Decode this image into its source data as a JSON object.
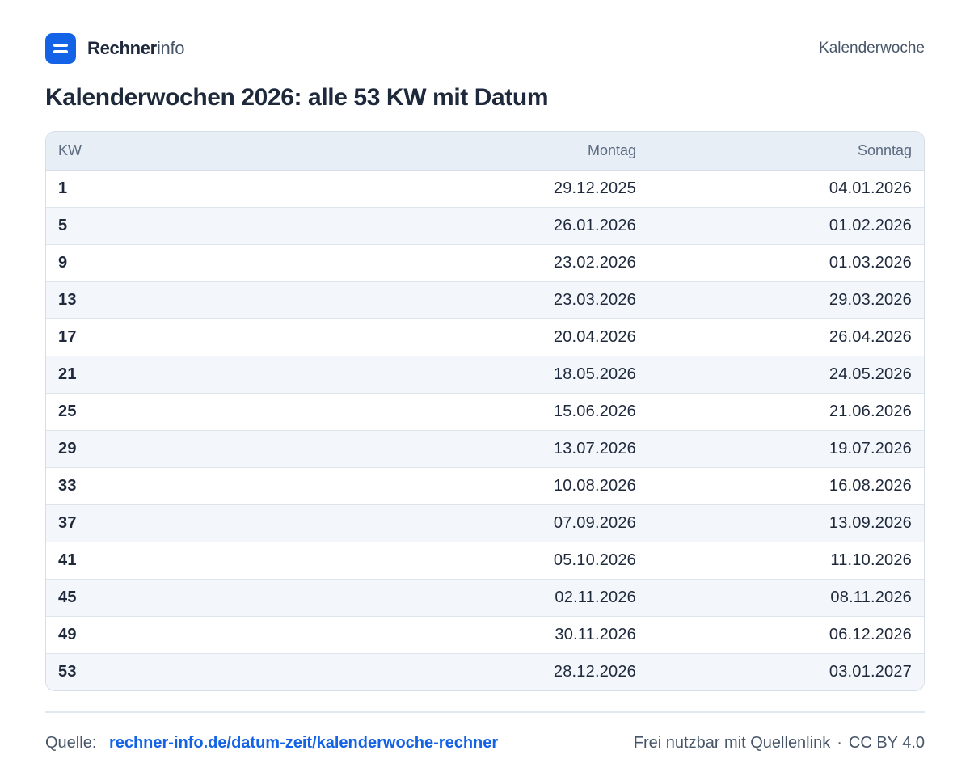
{
  "brand": {
    "name_bold": "Rechner",
    "name_light": "info"
  },
  "header": {
    "section_link": "Kalenderwoche"
  },
  "page": {
    "title": "Kalenderwochen 2026: alle 53 KW mit Datum"
  },
  "table": {
    "headers": [
      "KW",
      "Montag",
      "Sonntag"
    ],
    "rows": [
      [
        "1",
        "29.12.2025",
        "04.01.2026"
      ],
      [
        "5",
        "26.01.2026",
        "01.02.2026"
      ],
      [
        "9",
        "23.02.2026",
        "01.03.2026"
      ],
      [
        "13",
        "23.03.2026",
        "29.03.2026"
      ],
      [
        "17",
        "20.04.2026",
        "26.04.2026"
      ],
      [
        "21",
        "18.05.2026",
        "24.05.2026"
      ],
      [
        "25",
        "15.06.2026",
        "21.06.2026"
      ],
      [
        "29",
        "13.07.2026",
        "19.07.2026"
      ],
      [
        "33",
        "10.08.2026",
        "16.08.2026"
      ],
      [
        "37",
        "07.09.2026",
        "13.09.2026"
      ],
      [
        "41",
        "05.10.2026",
        "11.10.2026"
      ],
      [
        "45",
        "02.11.2026",
        "08.11.2026"
      ],
      [
        "49",
        "30.11.2026",
        "06.12.2026"
      ],
      [
        "53",
        "28.12.2026",
        "03.01.2027"
      ]
    ]
  },
  "footer": {
    "source_label": "Quelle:",
    "source_link": "rechner-info.de/datum-zeit/kalenderwoche-rechner",
    "license_note": "Frei nutzbar mit Quellenlink",
    "separator": "·",
    "license": "CC BY 4.0"
  },
  "colors": {
    "accent": "#1463e6",
    "text": "#1e293b",
    "muted": "#475569",
    "header_bg": "#e8eef6",
    "stripe_bg": "#f3f6fa"
  },
  "icons": {
    "logo": "rechner-logo-icon"
  }
}
